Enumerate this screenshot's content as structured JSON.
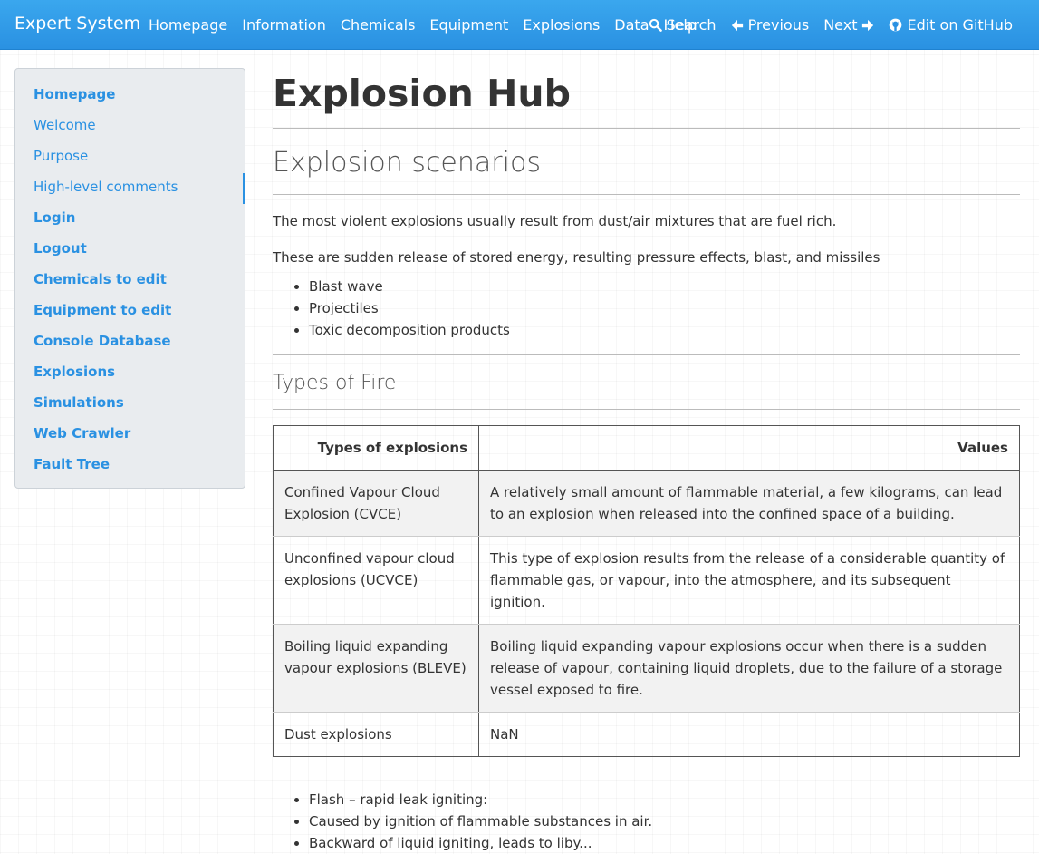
{
  "navbar": {
    "brand": "Expert System",
    "links": [
      "Homepage",
      "Information",
      "Chemicals",
      "Equipment",
      "Explosions",
      "Data",
      "Help"
    ],
    "search": "Search",
    "previous": "Previous",
    "next": "Next",
    "github": "Edit on GitHub"
  },
  "sidebar": {
    "items": [
      {
        "label": "Homepage",
        "bold": true
      },
      {
        "label": "Welcome",
        "bold": false
      },
      {
        "label": "Purpose",
        "bold": false
      },
      {
        "label": "High-level comments",
        "bold": false,
        "active": true
      },
      {
        "label": "Login",
        "bold": true
      },
      {
        "label": "Logout",
        "bold": true
      },
      {
        "label": "Chemicals to edit",
        "bold": true
      },
      {
        "label": "Equipment to edit",
        "bold": true
      },
      {
        "label": "Console Database",
        "bold": true
      },
      {
        "label": "Explosions",
        "bold": true
      },
      {
        "label": "Simulations",
        "bold": true
      },
      {
        "label": "Web Crawler",
        "bold": true
      },
      {
        "label": "Fault Tree",
        "bold": true
      }
    ]
  },
  "main": {
    "title": "Explosion Hub",
    "section1_title": "Explosion scenarios",
    "para1": "The most violent explosions usually result from dust/air mixtures that are fuel rich.",
    "para2": "These are sudden release of stored energy, resulting pressure effects, blast, and missiles",
    "bullets1": [
      "Blast wave",
      "Projectiles",
      "Toxic decomposition products"
    ],
    "section2_title": "Types of Fire",
    "table": {
      "headers": [
        "Types of explosions",
        "Values"
      ],
      "rows": [
        [
          "Confined Vapour Cloud Explosion (CVCE)",
          "A relatively small amount of flammable material, a few kilograms, can lead to an explosion when released into the confined space of a building."
        ],
        [
          "Unconfined vapour cloud explosions (UCVCE)",
          "This type of explosion results from the release of a considerable quantity of flammable gas, or vapour, into the atmosphere, and its subsequent ignition."
        ],
        [
          "Boiling liquid expanding vapour explosions (BLEVE)",
          "Boiling liquid expanding vapour explosions occur when there is a sudden release of vapour, containing liquid droplets, due to the failure of a storage vessel exposed to fire."
        ],
        [
          "Dust explosions",
          "NaN"
        ]
      ]
    },
    "bullets2": [
      "Flash – rapid leak igniting:",
      "Caused by ignition of flammable substances in air.",
      "Backward of liquid igniting, leads to liby..."
    ]
  },
  "colors": {
    "navbar": "#2a91e2",
    "link": "#2a91e2",
    "sidebar_bg": "#e9ecef"
  }
}
